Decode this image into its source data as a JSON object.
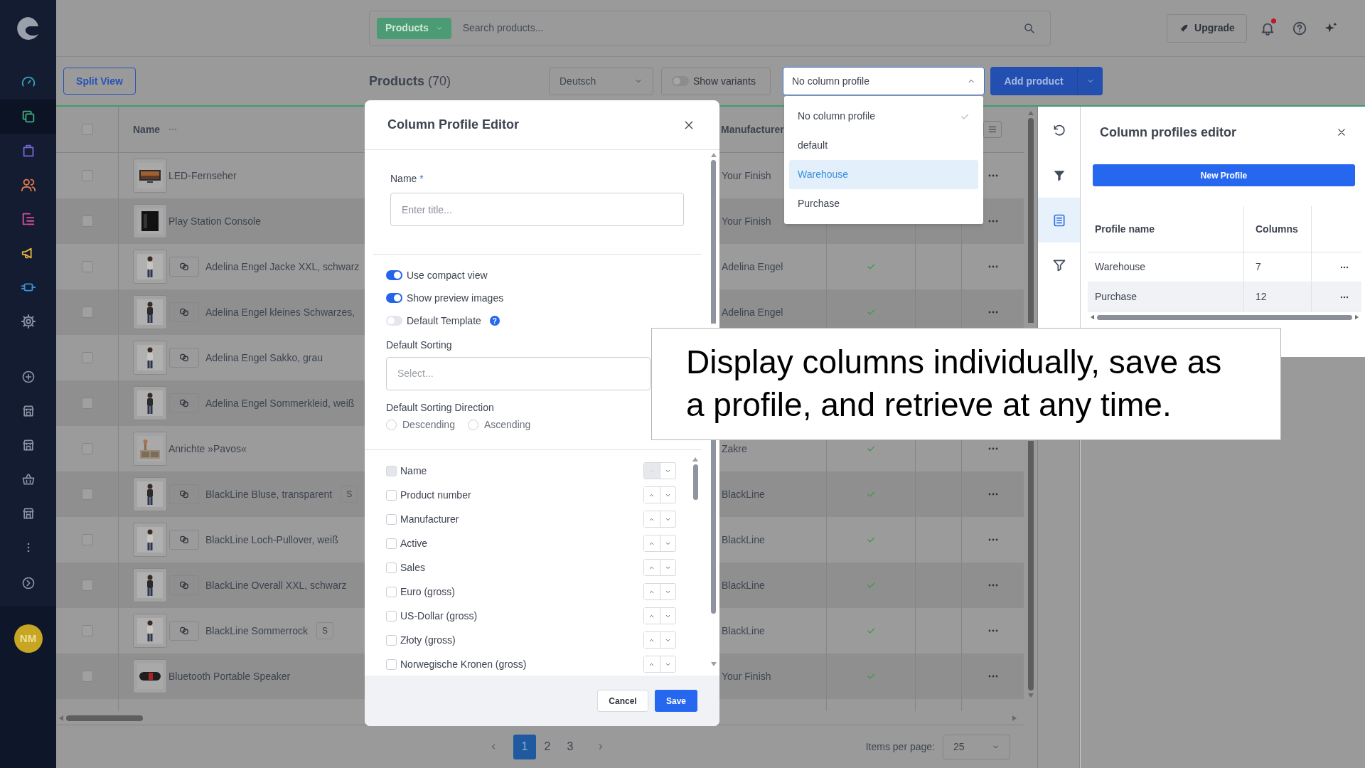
{
  "sidebar": {
    "items": [
      {
        "selected": false
      },
      {
        "selected": true
      },
      {
        "selected": false
      },
      {
        "selected": false
      },
      {
        "selected": false
      },
      {
        "selected": false
      },
      {
        "selected": false
      },
      {
        "selected": false
      }
    ],
    "avatar": "NM"
  },
  "topbar": {
    "scope": "Products",
    "search_placeholder": "Search products...",
    "upgrade": "Upgrade",
    "unread": true
  },
  "toolbar": {
    "split_view": "Split View",
    "title": "Products",
    "count": "(70)",
    "language": "Deutsch",
    "show_variants": {
      "label": "Show variants",
      "on": false
    },
    "column_profile": {
      "value": "No column profile",
      "expanded": true
    },
    "add_product": "Add product"
  },
  "profile_menu": [
    {
      "label": "No column profile",
      "selected": true,
      "highlighted": false
    },
    {
      "label": "default",
      "selected": false,
      "highlighted": false
    },
    {
      "label": "Warehouse",
      "selected": false,
      "highlighted": true
    },
    {
      "label": "Purchase",
      "selected": false,
      "highlighted": false
    }
  ],
  "table": {
    "header_checked": false,
    "columns": [
      "Name",
      "Manufacturer"
    ],
    "rows": [
      {
        "name": "LED-Fernseher",
        "checked": false,
        "variants": false,
        "manufacturer": "Your Finish"
      },
      {
        "name": "Play Station Console",
        "checked": false,
        "variants": false,
        "manufacturer": "Your Finish"
      },
      {
        "name": "Adelina Engel Jacke XXL, schwarz",
        "checked": false,
        "variants": true,
        "manufacturer": "Adelina Engel",
        "active": true
      },
      {
        "name": "Adelina Engel kleines Schwarzes,",
        "checked": false,
        "variants": true,
        "manufacturer": "Adelina Engel",
        "active": true
      },
      {
        "name": "Adelina Engel Sakko, grau",
        "checked": false,
        "variants": true
      },
      {
        "name": "Adelina Engel Sommerkleid, weiß",
        "checked": false,
        "variants": true
      },
      {
        "name": "Anrichte »Pavos«",
        "checked": false,
        "variants": false,
        "manufacturer": "Zakre",
        "active": true
      },
      {
        "name": "BlackLine Bluse, transparent",
        "checked": false,
        "variants": true,
        "badge": "S",
        "manufacturer": "BlackLine",
        "active": true
      },
      {
        "name": "BlackLine Loch-Pullover, weiß",
        "checked": false,
        "variants": true,
        "manufacturer": "BlackLine",
        "active": true
      },
      {
        "name": "BlackLine Overall XXL, schwarz",
        "checked": false,
        "variants": true,
        "manufacturer": "BlackLine",
        "active": true
      },
      {
        "name": "BlackLine Sommerrock",
        "checked": false,
        "variants": true,
        "badge": "S",
        "manufacturer": "BlackLine",
        "active": true
      },
      {
        "name": "Bluetooth Portable Speaker",
        "checked": false,
        "variants": false,
        "manufacturer": "Your Finish",
        "active": true
      }
    ]
  },
  "pagination": {
    "pages": [
      {
        "label": "1",
        "selected": true
      },
      {
        "label": "2",
        "selected": false
      },
      {
        "label": "3",
        "selected": false
      }
    ],
    "items_per_page_label": "Items per page:",
    "items_per_page": "25"
  },
  "modal": {
    "title": "Column Profile Editor",
    "name_label": "Name",
    "required_mark": "*",
    "name_placeholder": "Enter title...",
    "toggles": [
      {
        "label": "Use compact view",
        "on": true
      },
      {
        "label": "Show preview images",
        "on": true
      },
      {
        "label": "Default Template",
        "on": false,
        "help": "?"
      }
    ],
    "sorting_label": "Default Sorting",
    "sorting_placeholder": "Select...",
    "direction_label": "Default Sorting Direction",
    "directions": [
      {
        "label": "Descending",
        "selected": false
      },
      {
        "label": "Ascending",
        "selected": false
      }
    ],
    "columns": [
      {
        "label": "Name",
        "checked": false,
        "disabled": true
      },
      {
        "label": "Product number",
        "checked": false,
        "disabled": false
      },
      {
        "label": "Manufacturer",
        "checked": false,
        "disabled": false
      },
      {
        "label": "Active",
        "checked": false,
        "disabled": false
      },
      {
        "label": "Sales",
        "checked": false,
        "disabled": false
      },
      {
        "label": "Euro (gross)",
        "checked": false,
        "disabled": false
      },
      {
        "label": "US-Dollar (gross)",
        "checked": false,
        "disabled": false
      },
      {
        "label": "Złoty (gross)",
        "checked": false,
        "disabled": false
      },
      {
        "label": "Norwegische Kronen (gross)",
        "checked": false,
        "disabled": false
      }
    ],
    "cancel": "Cancel",
    "save": "Save"
  },
  "profiles_panel": {
    "rail": [
      {
        "selected": false
      },
      {
        "selected": false
      },
      {
        "selected": true
      },
      {
        "selected": false
      }
    ],
    "title": "Column profiles editor",
    "new_profile": "New Profile",
    "columns": [
      "Profile name",
      "Columns"
    ],
    "rows": [
      {
        "name": "Warehouse",
        "columns": "7",
        "highlighted": false
      },
      {
        "name": "Purchase",
        "columns": "12",
        "highlighted": true
      }
    ]
  },
  "caption": "Display columns individually, save as a profile, and retrieve at any time."
}
